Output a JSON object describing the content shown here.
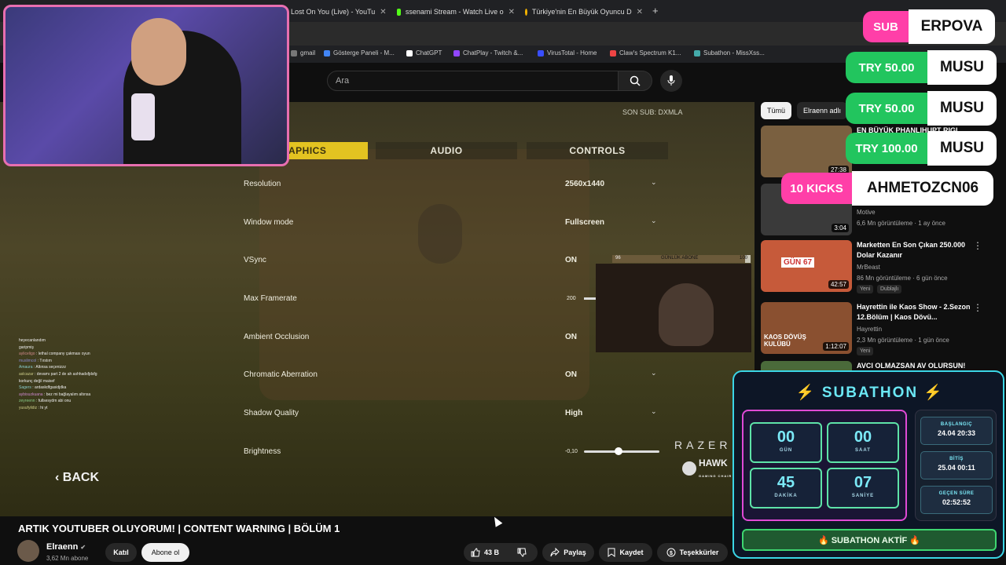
{
  "browser": {
    "tabs": [
      {
        "title": "Lost On You (Live) - YouTu",
        "color": "#ff0000"
      },
      {
        "title": "ssenami Stream - Watch Live o",
        "color": "#53fc18"
      },
      {
        "title": "Türkiye'nin En Büyük Oyuncu D",
        "color": "#f5b400"
      }
    ],
    "new_tab_icon": "+",
    "bookmarks": [
      {
        "label": "gmail",
        "color": "#777"
      },
      {
        "label": "Gösterge Paneli - M...",
        "color": "#4285f4"
      },
      {
        "label": "ChatGPT",
        "color": "#ffffff"
      },
      {
        "label": "ChatPlay - Twitch &...",
        "color": "#9146ff"
      },
      {
        "label": "VirusTotal - Home",
        "color": "#394eff"
      },
      {
        "label": "Claw's Spectrum K1...",
        "color": "#e44"
      },
      {
        "label": "Subathon - MissXss...",
        "color": "#4aa"
      }
    ]
  },
  "youtube": {
    "search_placeholder": "Ara",
    "chips": [
      {
        "label": "Tümü",
        "active": true
      },
      {
        "label": "Elraenn adlı"
      }
    ],
    "video_title": "ARTIK YOUTUBER OLUYORUM! | CONTENT WARNING | BÖLÜM 1",
    "channel": {
      "name": "Elraenn",
      "verified_icon": "check-circle-icon",
      "subs": "3,62 Mn abone"
    },
    "buttons": {
      "join": "Katıl",
      "subscribe": "Abone ol",
      "likes": "43 B",
      "share": "Paylaş",
      "save": "Kaydet",
      "thanks": "Teşekkürler"
    },
    "related": [
      {
        "title": "EN BÜYÜK PHANLIHUPT RIGI",
        "channel": "",
        "meta": "",
        "duration": "27:38",
        "thumb_color": "#7a6040"
      },
      {
        "title": "",
        "channel": "Motive",
        "meta": "6,6 Mn görüntüleme · 1 ay önce",
        "duration": "3:04",
        "thumb_color": "#3a3a3a"
      },
      {
        "title": "Marketten En Son Çıkan 250.000 Dolar Kazanır",
        "channel": "MrBeast",
        "meta": "86 Mn görüntüleme · 6 gün önce",
        "badges": [
          "Yeni",
          "Dublajlı"
        ],
        "duration": "42:57",
        "thumb_color": "#c65a3a",
        "thumb_text": "GÜN 67"
      },
      {
        "title": "Hayrettin ile Kaos Show - 2.Sezon 12.Bölüm | Kaos Dövü...",
        "channel": "Hayrettin",
        "meta": "2,3 Mn görüntüleme · 1 gün önce",
        "badges": [
          "Yeni"
        ],
        "duration": "1:12:07",
        "thumb_color": "#8a5030",
        "thumb_text": "KAOS DÖVÜŞ KULÜBÜ"
      },
      {
        "title": "AVCI OLMAZSAN AV OLURSUN!",
        "channel": "",
        "meta": "",
        "duration": "",
        "thumb_color": "#4a6a3a"
      }
    ]
  },
  "game": {
    "son_sub": "SON SUB: DXMLA",
    "tabs": [
      "GRAPHICS",
      "AUDIO",
      "CONTROLS"
    ],
    "active_tab": "GRAPHICS",
    "settings": [
      {
        "label": "Resolution",
        "value": "2560x1440",
        "dropdown": true
      },
      {
        "label": "Window mode",
        "value": "Fullscreen",
        "dropdown": true
      },
      {
        "label": "VSync",
        "value": "ON",
        "dropdown": false
      },
      {
        "label": "Max Framerate",
        "value": "200",
        "dropdown": false
      },
      {
        "label": "Ambient Occlusion",
        "value": "ON",
        "dropdown": false
      },
      {
        "label": "Chromatic Aberration",
        "value": "ON",
        "dropdown": true
      },
      {
        "label": "Shadow Quality",
        "value": "High",
        "dropdown": true
      },
      {
        "label": "Brightness",
        "value": "-0,10",
        "dropdown": false,
        "level": 0.45
      }
    ],
    "back": "BACK",
    "sponsor": "RAZER",
    "sponsor2": "HAWK",
    "sponsor2_sub": "GAMING CHAIR",
    "goal_bar": {
      "start": "96",
      "label": "GÜNLÜK ABONE",
      "end": "100",
      "progress": 0.96
    },
    "chat": [
      {
        "user": "",
        "msg": "heyecanlandım",
        "color": "#fff"
      },
      {
        "user": "",
        "msg": "garipmiş",
        "color": "#8c8"
      },
      {
        "user": "ayliceligo",
        "msg": "lethal company çakması oyun",
        "color": "#c88"
      },
      {
        "user": "muslimcol",
        "msg": "Tırstım",
        "color": "#88c"
      },
      {
        "user": "Amaura",
        "msg": "Altınsa seçenizzz",
        "color": "#8cc"
      },
      {
        "user": "aslcazar",
        "msg": "devamı part 2 de ah ashhadsfjdsfg",
        "color": "#cc8"
      },
      {
        "user": "",
        "msg": "korkunç değil maisef",
        "color": "#c44"
      },
      {
        "user": "Sagers",
        "msg": "ardaskdfgasidjdka",
        "color": "#8cc"
      },
      {
        "user": "aybisuzkuana",
        "msg": "bez mi bağlayalım altınsa",
        "color": "#c8c"
      },
      {
        "user": "zeyreenn",
        "msg": "fullsesydm abi onu",
        "color": "#8c8"
      },
      {
        "user": "yusufyildiz",
        "msg": "hi yt",
        "color": "#cc8"
      }
    ]
  },
  "alerts": [
    {
      "type": "SUB",
      "user": "ERPOVA",
      "color": "#ff3fa8"
    },
    {
      "type": "TRY 50.00",
      "user": "MUSU",
      "color": "#22c55e"
    },
    {
      "type": "TRY 50.00",
      "user": "MUSU",
      "color": "#22c55e"
    },
    {
      "type": "TRY 100.00",
      "user": "MUSU",
      "color": "#22c55e"
    },
    {
      "type": "10 KICKS",
      "user": "AHMETOZCN06",
      "color": "#ff3fa8"
    }
  ],
  "subathon": {
    "title": "SUBATHON",
    "icon": "lightning-icon",
    "timer": [
      {
        "value": "00",
        "unit": "GÜN"
      },
      {
        "value": "00",
        "unit": "SAAT"
      },
      {
        "value": "45",
        "unit": "DAKİKA"
      },
      {
        "value": "07",
        "unit": "SANİYE"
      }
    ],
    "info": [
      {
        "label": "BAŞLANGIÇ",
        "value": "24.04 20:33"
      },
      {
        "label": "BİTİŞ",
        "value": "25.04 00:11"
      },
      {
        "label": "GEÇEN SÜRE",
        "value": "02:52:52"
      }
    ],
    "status": "🔥 SUBATHON AKTİF 🔥"
  }
}
